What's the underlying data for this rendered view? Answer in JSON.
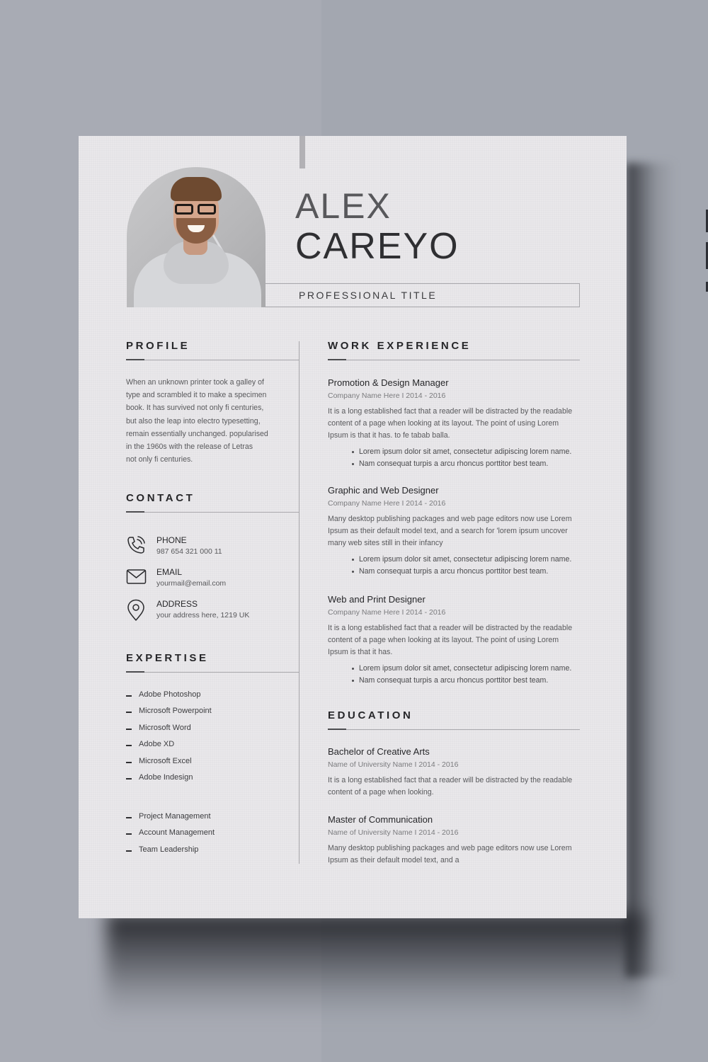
{
  "colors": {
    "page": "#e4e3e6",
    "background": "#a8abb4",
    "heading": "#262629",
    "body_text": "#59595c",
    "meta_text": "#7b7b7e",
    "rule": "#a9a8ac"
  },
  "header": {
    "first_name": "ALEX",
    "last_name": "CAREYO",
    "professional_title": "PROFESSIONAL TITLE",
    "photo": "portrait-photo"
  },
  "profile": {
    "heading": "PROFILE",
    "lines": [
      "When an unknown printer took a galley of",
      "type and scrambled it to make a specimen",
      "book. It has survived not only fi centuries,",
      "but also the leap into electro typesetting,",
      "remain essentially unchanged. popularised",
      "in the 1960s with the release of Letras",
      "not only fi centuries."
    ]
  },
  "contact": {
    "heading": "CONTACT",
    "items": [
      {
        "icon": "phone-icon",
        "label": "PHONE",
        "value": "987 654 321 000 11"
      },
      {
        "icon": "email-icon",
        "label": "EMAIL",
        "value": "yourmail@email.com"
      },
      {
        "icon": "location-pin-icon",
        "label": "ADDRESS",
        "value": "your address here, 1219 UK"
      }
    ]
  },
  "expertise": {
    "heading": "EXPERTISE",
    "software": [
      "Adobe Photoshop",
      "Microsoft Powerpoint",
      "Microsoft Word",
      "Adobe XD",
      "Microsoft Excel",
      "Adobe Indesign"
    ],
    "soft_skills": [
      "Project Management",
      "Account Management",
      "Team Leadership"
    ]
  },
  "work_experience": {
    "heading": "WORK EXPERIENCE",
    "jobs": [
      {
        "title": "Promotion & Design Manager",
        "meta": "Company Name Here  I  2014 - 2016",
        "description": [
          "It is a long established fact that a reader will be distracted by the readable",
          "content of a page when looking at its layout. The point of using Lorem",
          "Ipsum is that it has. to fe tabab balla."
        ],
        "bullets": [
          "Lorem ipsum dolor sit amet, consectetur adipiscing lorem name.",
          "Nam consequat turpis a arcu rhoncus porttitor best team."
        ]
      },
      {
        "title": "Graphic and Web Designer",
        "meta": "Company Name Here  I  2014 - 2016",
        "description": [
          "Many desktop publishing packages and web page editors now use Lorem",
          "Ipsum as their default model text, and a search for 'lorem ipsum uncover",
          "many web sites still in their infancy"
        ],
        "bullets": [
          "Lorem ipsum dolor sit amet, consectetur adipiscing lorem name.",
          "Nam consequat turpis a arcu rhoncus porttitor best team."
        ]
      },
      {
        "title": "Web and Print Designer",
        "meta": "Company Name Here  I  2014 - 2016",
        "description": [
          "It is a long established fact that a reader will be distracted by the readable",
          "content of a page when looking at its layout. The point of using Lorem",
          "Ipsum is that it has."
        ],
        "bullets": [
          "Lorem ipsum dolor sit amet, consectetur adipiscing lorem name.",
          "Nam consequat turpis a arcu rhoncus porttitor best team."
        ]
      }
    ]
  },
  "education": {
    "heading": "EDUCATION",
    "entries": [
      {
        "title": "Bachelor of Creative Arts",
        "meta": "Name of University Name  I  2014 - 2016",
        "description": [
          "It is a long established fact that a reader will be distracted by the readable",
          "content of a page when looking."
        ]
      },
      {
        "title": "Master of Communication",
        "meta": "Name of University Name  I  2014 - 2016",
        "description": [
          "Many desktop publishing packages and web page editors now use Lorem",
          "Ipsum as their default model text, and a"
        ]
      }
    ]
  }
}
